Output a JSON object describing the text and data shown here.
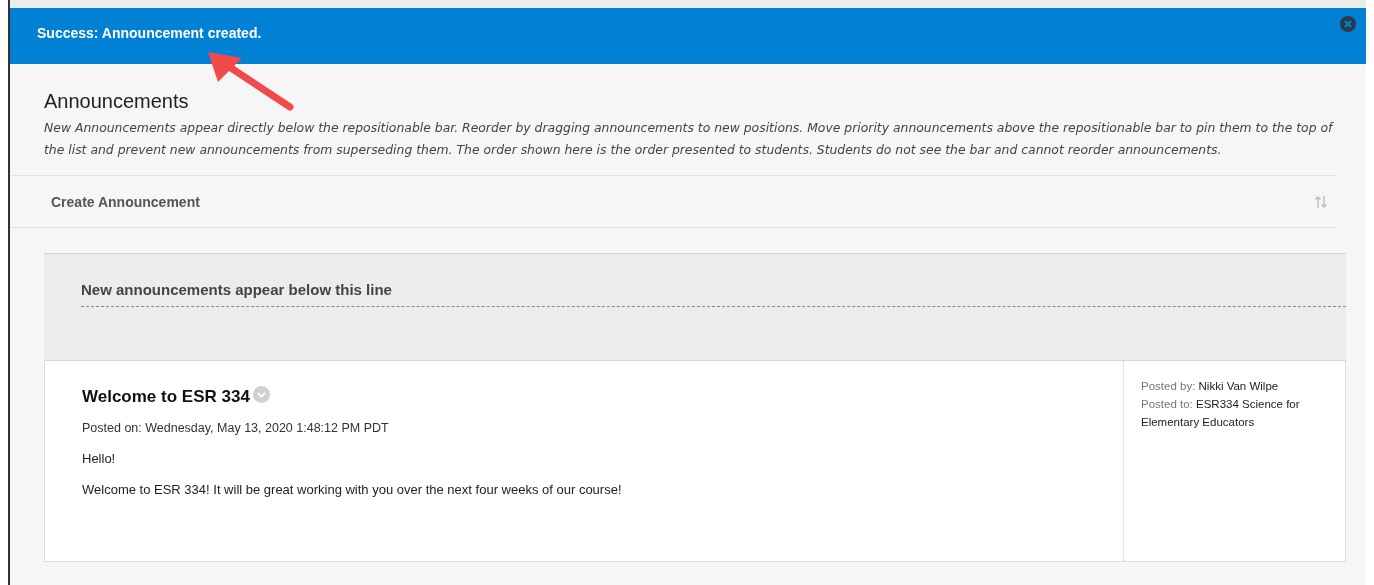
{
  "banner": {
    "message": "Success: Announcement created."
  },
  "annotation": {
    "kind": "arrow"
  },
  "page": {
    "title": "Announcements",
    "description": "New Announcements appear directly below the repositionable bar. Reorder by dragging announcements to new positions. Move priority announcements above the repositionable bar to pin them to the top of the list and prevent new announcements from superseding them. The order shown here is the order presented to students. Students do not see the bar and cannot reorder announcements."
  },
  "action_bar": {
    "create_label": "Create Announcement"
  },
  "divider_bar": {
    "label": "New announcements appear below this line"
  },
  "announcements": [
    {
      "title": "Welcome to ESR 334",
      "posted_on": "Posted on: Wednesday, May 13, 2020 1:48:12 PM PDT",
      "body": [
        "Hello!",
        "Welcome to ESR 334! It will be great working with you over the next four weeks of our course!"
      ],
      "posted_by_label": "Posted by:",
      "posted_by": "Nikki Van Wilpe",
      "posted_to_label": "Posted to:",
      "posted_to": "ESR334 Science for Elementary Educators"
    }
  ]
}
